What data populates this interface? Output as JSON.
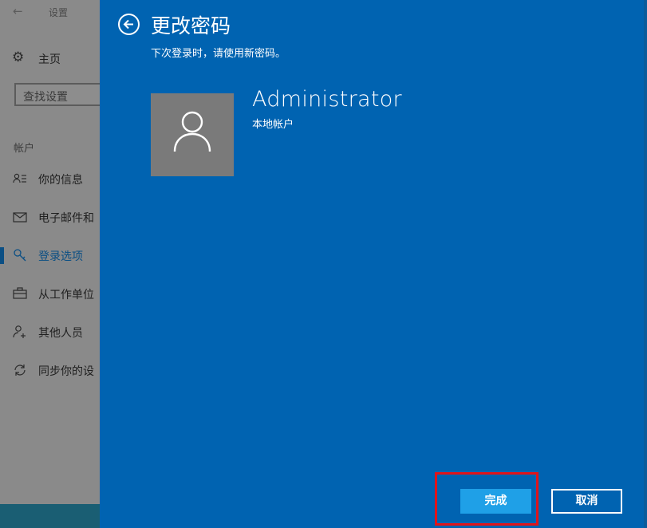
{
  "background_window": {
    "title": "设置",
    "home_label": "主页",
    "search_placeholder": "查找设置",
    "section_label": "帐户",
    "nav_items": [
      {
        "label": "你的信息",
        "icon": "person-list-icon"
      },
      {
        "label": "电子邮件和",
        "icon": "mail-icon"
      },
      {
        "label": "登录选项",
        "icon": "key-icon",
        "active": true
      },
      {
        "label": "从工作单位",
        "icon": "briefcase-icon"
      },
      {
        "label": "其他人员",
        "icon": "person-add-icon"
      },
      {
        "label": "同步你的设",
        "icon": "sync-icon"
      }
    ]
  },
  "dialog": {
    "title": "更改密码",
    "subtitle": "下次登录时，请使用新密码。",
    "user_name": "Administrator",
    "account_type": "本地帐户",
    "finish_label": "完成",
    "cancel_label": "取消"
  },
  "colors": {
    "dialog_bg": "#0063b1",
    "primary_button": "#1fa0e7",
    "highlight": "#e0141a",
    "avatar_bg": "#7a7a7a"
  }
}
